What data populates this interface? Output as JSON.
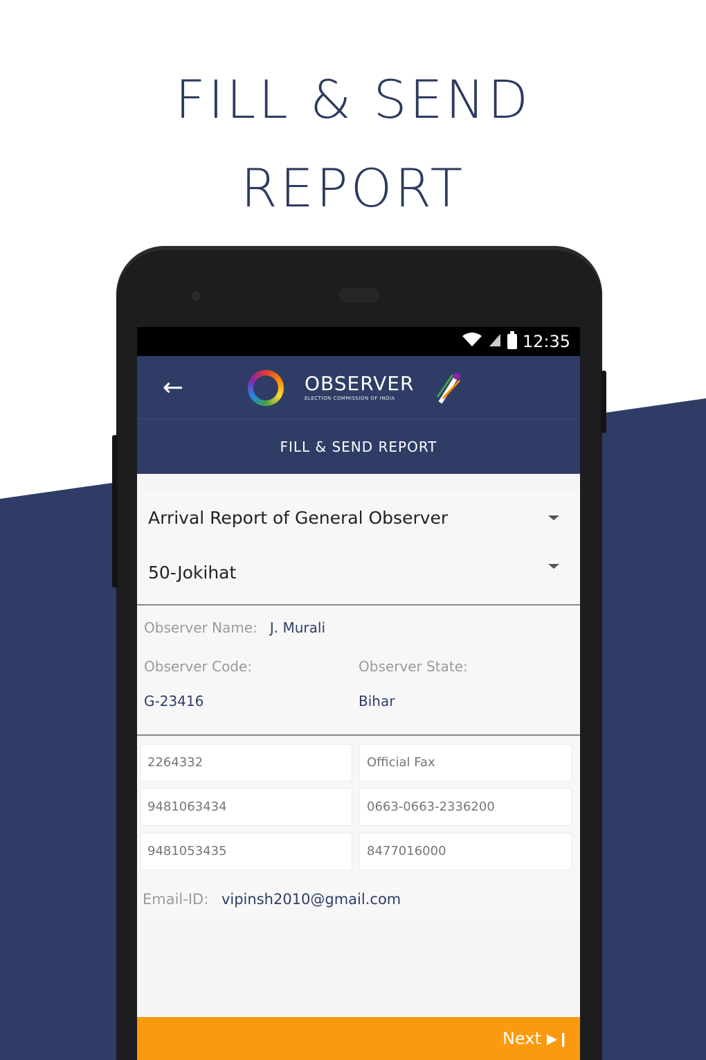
{
  "headline": {
    "line1": "FILL & SEND",
    "line2": "REPORT"
  },
  "status_bar": {
    "time": "12:35",
    "wifi_icon": "wifi-icon",
    "signal_icon": "signal-icon",
    "battery_icon": "battery-icon"
  },
  "app_bar": {
    "back_icon": "arrow-left-icon",
    "logo_title": "OBSERVER",
    "logo_subtitle": "ELECTION COMMISSION OF INDIA"
  },
  "sub_header": {
    "title": "FILL & SEND REPORT"
  },
  "form": {
    "report_type": {
      "value": "Arrival Report of General Observer"
    },
    "constituency": {
      "value": "50-Jokihat"
    },
    "observer_name": {
      "label": "Observer Name:",
      "value": "J. Murali"
    },
    "observer_code": {
      "label": "Observer Code:",
      "value": "G-23416"
    },
    "observer_state": {
      "label": "Observer State:",
      "value": "Bihar"
    },
    "fields": [
      {
        "left": "2264332",
        "right": "Official Fax"
      },
      {
        "left": "9481063434",
        "right": "0663-0663-2336200"
      },
      {
        "left": "9481053435",
        "right": "8477016000"
      }
    ],
    "email": {
      "label": "Email-ID:",
      "value": "vipinsh2010@gmail.com"
    }
  },
  "footer": {
    "next_label": "Next",
    "next_icon": "skip-next-icon"
  },
  "colors": {
    "navy": "#2f3d66",
    "orange": "#fb9a0e",
    "headline": "#2c3a5e"
  }
}
